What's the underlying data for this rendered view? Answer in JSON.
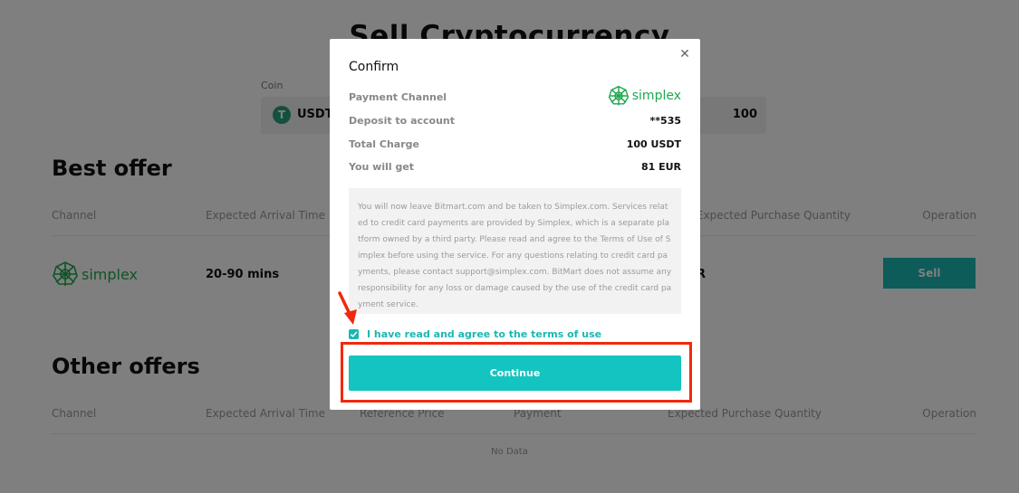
{
  "page": {
    "title": "Sell Cryptocurrency",
    "coin_label": "Coin",
    "coin_symbol": "T",
    "coin_name": "USDT",
    "amount": "100"
  },
  "best_offer": {
    "title": "Best offer",
    "columns": [
      "Channel",
      "Expected Arrival Time",
      "Expected Purchase Quantity",
      "Operation"
    ],
    "channel_logo": "simplex",
    "arrival_time": "20-90 mins",
    "quantity_partial": "R",
    "sell_label": "Sell"
  },
  "other_offers": {
    "title": "Other offers",
    "columns": [
      "Channel",
      "Expected Arrival Time",
      "Reference Price",
      "Payment",
      "Expected Purchase Quantity",
      "Operation"
    ],
    "empty_text": "No Data"
  },
  "modal": {
    "title": "Confirm",
    "close_icon": "close-icon",
    "rows": [
      {
        "label": "Payment Channel",
        "value": "simplex"
      },
      {
        "label": "Deposit to account",
        "value": "**535"
      },
      {
        "label": "Total Charge",
        "value": "100 USDT"
      },
      {
        "label": "You will get",
        "value": "81 EUR"
      }
    ],
    "notice": "You will now leave Bitmart.com and be taken to Simplex.com. Services related to credit card payments are provided by Simplex, which is a separate platform owned by a third party. Please read and agree to the Terms of Use of Simplex before using the service. For any questions relating to credit card payments, please contact support@simplex.com. BitMart does not assume any responsibility for any loss or damage caused by the use of the credit card payment service.",
    "agree_text": "I have read and agree to the terms of use",
    "agree_checked": true,
    "continue_label": "Continue"
  },
  "colors": {
    "accent": "#14c4c0",
    "simplex_green": "#1fa84f",
    "annotation_red": "#f2280e",
    "tether_green": "#26a17b"
  }
}
